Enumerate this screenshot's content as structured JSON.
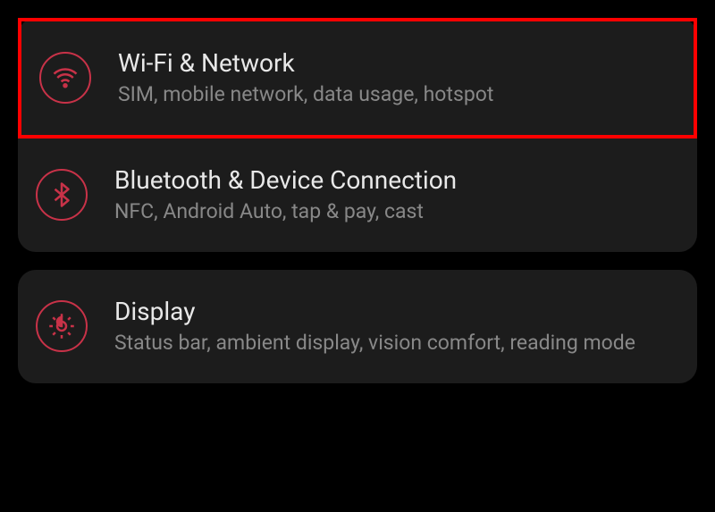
{
  "colors": {
    "accent": "#c83248",
    "highlight": "#ff0000",
    "card": "#1c1c1c",
    "title": "#e8e8e8",
    "subtitle": "#888"
  },
  "groups": [
    {
      "items": [
        {
          "icon": "wifi-icon",
          "title": "Wi-Fi & Network",
          "subtitle": "SIM, mobile network, data usage, hotspot",
          "highlighted": true
        },
        {
          "icon": "bluetooth-icon",
          "title": "Bluetooth & Device Connection",
          "subtitle": "NFC, Android Auto, tap & pay, cast",
          "highlighted": false
        }
      ]
    },
    {
      "items": [
        {
          "icon": "display-icon",
          "title": "Display",
          "subtitle": "Status bar, ambient display, vision comfort, reading mode",
          "highlighted": false
        }
      ]
    }
  ]
}
